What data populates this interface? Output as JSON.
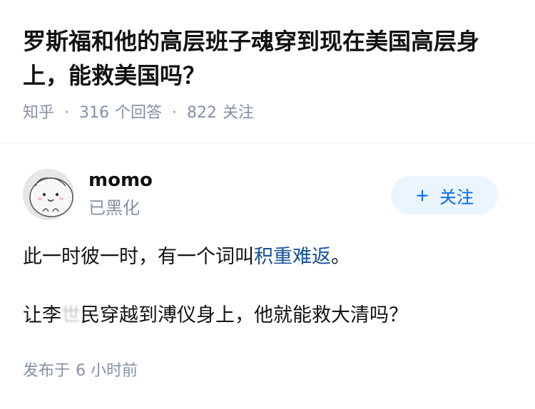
{
  "question": {
    "title": "罗斯福和他的高层班子魂穿到现在美国高层身上，能救美国吗？",
    "source": "知乎",
    "separator": "·",
    "answer_count": "316",
    "answer_label": "个回答",
    "follower_count": "822",
    "follower_label": "关注"
  },
  "author": {
    "name": "momo",
    "headline": "已黑化",
    "avatar_icon": "cartoon-avatar-icon"
  },
  "follow_button": {
    "icon": "+",
    "label": "关注"
  },
  "answer": {
    "p1_before": "此一时彼一时，有一个词叫",
    "p1_link": "积重难返",
    "p1_after": "。",
    "p2_before": "让李",
    "p2_masked": "世",
    "p2_after": "民穿越到溥仪身上，他就能救大清吗？"
  },
  "publish": {
    "prefix": "发布于",
    "time": "6 小时前"
  },
  "colors": {
    "link": "#175199",
    "meta": "#8590a6",
    "follow_bg": "#ebf5ff",
    "follow_text": "#0066ff"
  }
}
